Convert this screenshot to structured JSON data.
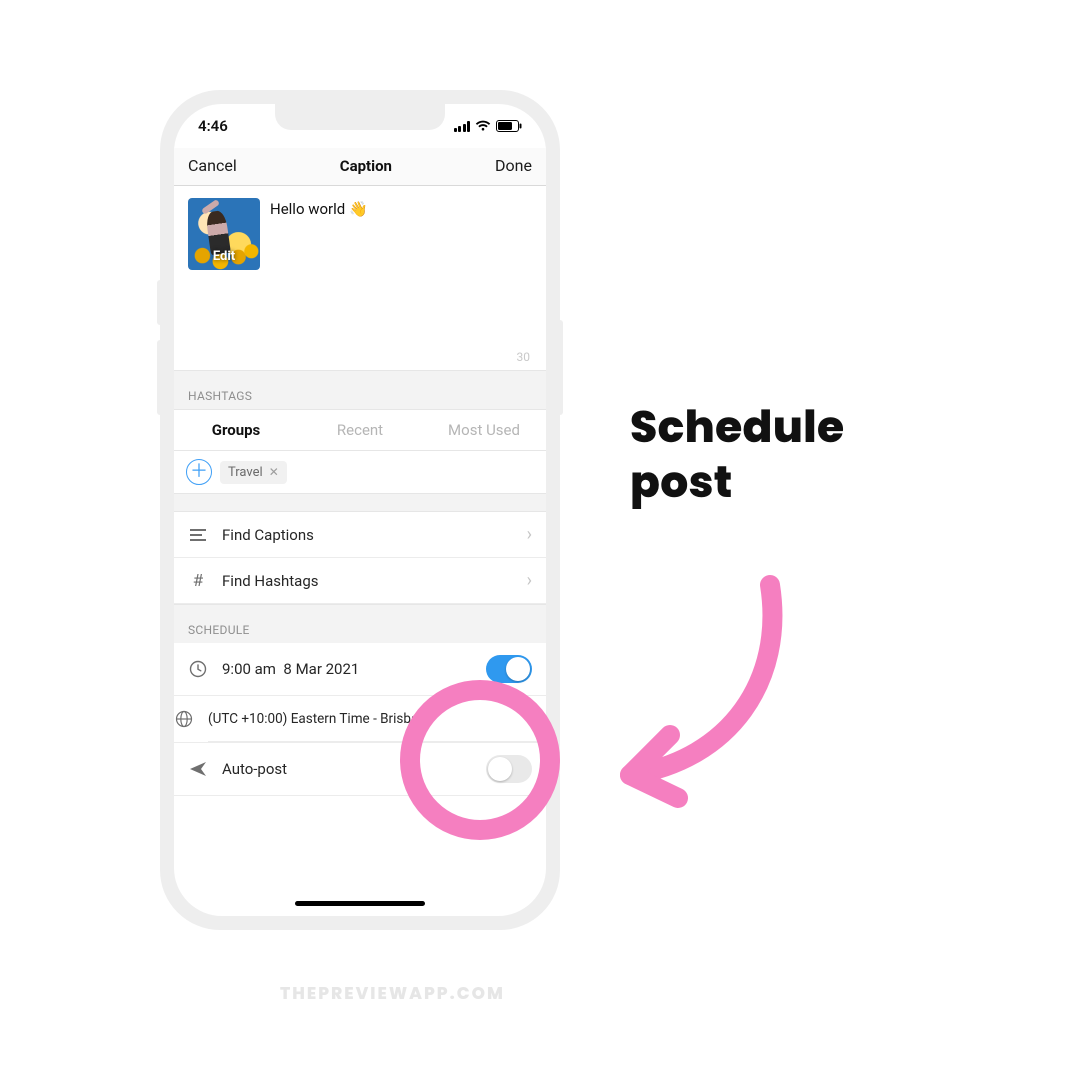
{
  "statusbar": {
    "time": "4:46"
  },
  "navbar": {
    "cancel": "Cancel",
    "title": "Caption",
    "done": "Done"
  },
  "caption": {
    "text": "Hello world 👋",
    "edit_label": "Edit",
    "char_count": "30"
  },
  "hashtags": {
    "header": "HASHTAGS",
    "tabs": {
      "groups": "Groups",
      "recent": "Recent",
      "most_used": "Most Used"
    },
    "chip": "Travel"
  },
  "rows": {
    "find_captions": "Find Captions",
    "find_hashtags": "Find Hashtags"
  },
  "schedule": {
    "header": "SCHEDULE",
    "time": "9:00 am",
    "date": "8 Mar 2021",
    "timezone": "(UTC +10:00) Eastern Time - Brisbane",
    "autopost": "Auto-post"
  },
  "callout": {
    "line1": "Schedule",
    "line2": "post"
  },
  "watermark": "THEPREVIEWAPP.COM"
}
